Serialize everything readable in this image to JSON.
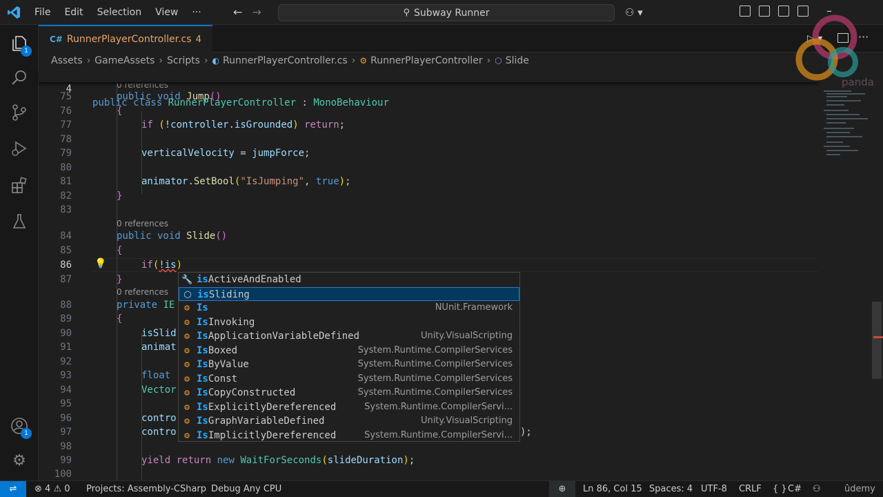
{
  "app": {
    "search_text": "Subway Runner"
  },
  "menu": {
    "file": "File",
    "edit": "Edit",
    "selection": "Selection",
    "view": "View",
    "more": "···"
  },
  "tab": {
    "icon": "C#",
    "filename": "RunnerPlayerController.cs",
    "problems": "4"
  },
  "breadcrumb": {
    "assets": "Assets",
    "gameassets": "GameAssets",
    "scripts": "Scripts",
    "file": "RunnerPlayerController.cs",
    "class": "RunnerPlayerController",
    "method": "Slide"
  },
  "activity_badges": {
    "explorer": "1",
    "accounts": "1"
  },
  "editor": {
    "sticky": {
      "num": "4",
      "kw1": "public",
      "kw2": "class",
      "name": "RunnerPlayerController",
      "colon": " : ",
      "base": "MonoBehaviour"
    },
    "codelens": {
      "partial": "0 references",
      "slide": "0 references",
      "coroutine": "0 references"
    },
    "lines": {
      "n75": "75",
      "n76": "76",
      "n77": "77",
      "n78": "78",
      "n79": "79",
      "n80": "80",
      "n81": "81",
      "n82": "82",
      "n83": "83",
      "n84": "84",
      "n85": "85",
      "n86": "86",
      "n87": "87",
      "n88": "88",
      "n89": "89",
      "n90": "90",
      "n91": "91",
      "n92": "92",
      "n93": "93",
      "n94": "94",
      "n95": "95",
      "n96": "96",
      "n97": "97",
      "n98": "98",
      "n99": "99",
      "n100": "100"
    },
    "code": {
      "jump_kw": "public void",
      "jump_fn": "Jump",
      "if": "if",
      "controller": "controller",
      "grounded": "isGrounded",
      "ret": "return",
      "vv": "verticalVelocity",
      "jf": "jumpForce",
      "animator": "animator",
      "setbool": "SetBool",
      "isjumping": "\"IsJumping\"",
      "true_kw": "true",
      "slide_kw": "public void",
      "slide_fn": "Slide",
      "typed_if": "if",
      "typed_is": "is",
      "private_kw": "private",
      "private_rest": "IE",
      "l90": "isSlid",
      "l91": "animat",
      "l93_kw": "float",
      "l94": "Vector",
      "l96": "contro",
      "l97": "contro",
      "l97_tail": ");",
      "yield": "yield",
      "return2": "return",
      "new_kw": "new",
      "wfs": "WaitForSeconds",
      "sd": "slideDuration"
    }
  },
  "suggest": [
    {
      "icon": "wrench-icon",
      "match": "is",
      "rest": "ActiveAndEnabled",
      "detail": ""
    },
    {
      "icon": "cube-icon",
      "match": "is",
      "rest": "Sliding",
      "detail": ""
    },
    {
      "icon": "class-icon",
      "match": "Is",
      "rest": "",
      "detail": "NUnit.Framework"
    },
    {
      "icon": "class-icon",
      "match": "Is",
      "rest": "Invoking",
      "detail": ""
    },
    {
      "icon": "class-icon",
      "match": "Is",
      "rest": "ApplicationVariableDefined",
      "detail": "Unity.VisualScripting"
    },
    {
      "icon": "class-icon",
      "match": "Is",
      "rest": "Boxed",
      "detail": "System.Runtime.CompilerServices"
    },
    {
      "icon": "class-icon",
      "match": "Is",
      "rest": "ByValue",
      "detail": "System.Runtime.CompilerServices"
    },
    {
      "icon": "class-icon",
      "match": "Is",
      "rest": "Const",
      "detail": "System.Runtime.CompilerServices"
    },
    {
      "icon": "class-icon",
      "match": "Is",
      "rest": "CopyConstructed",
      "detail": "System.Runtime.CompilerServices"
    },
    {
      "icon": "class-icon",
      "match": "Is",
      "rest": "ExplicitlyDereferenced",
      "detail": "System.Runtime.CompilerServi..."
    },
    {
      "icon": "class-icon",
      "match": "Is",
      "rest": "GraphVariableDefined",
      "detail": "Unity.VisualScripting"
    },
    {
      "icon": "class-icon",
      "match": "Is",
      "rest": "ImplicitlyDereferenced",
      "detail": "System.Runtime.CompilerServi..."
    }
  ],
  "status": {
    "errors": "4",
    "warnings": "0",
    "projects": "Projects: Assembly-CSharp",
    "debug": "Debug Any CPU",
    "position": "Ln 86, Col 15",
    "spaces": "Spaces: 4",
    "encoding": "UTF-8",
    "eol": "CRLF",
    "braces": "{ }",
    "language": "C#"
  },
  "watermark": {
    "text": "panda",
    "udemy": "ûdemy"
  },
  "colors": {
    "accent": "#0078d4",
    "tab_modified": "#e9a56c",
    "match": "#2aaaff"
  }
}
